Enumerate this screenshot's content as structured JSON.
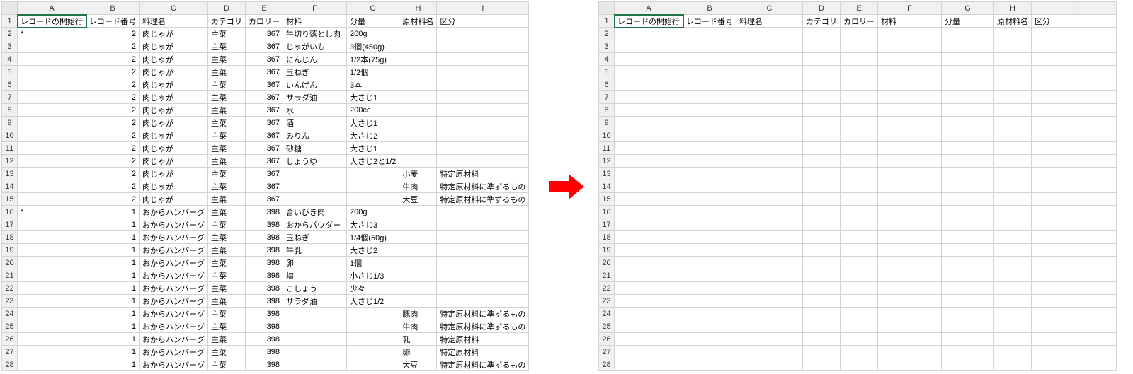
{
  "columns": [
    "A",
    "B",
    "C",
    "D",
    "E",
    "F",
    "G",
    "H",
    "I"
  ],
  "headers": {
    "A": "レコードの開始行",
    "B": "レコード番号",
    "C": "料理名",
    "D": "カテゴリ",
    "E": "カロリー",
    "F": "材料",
    "G": "分量",
    "H": "原材料名",
    "I": "区分"
  },
  "left_rows": [
    {
      "A": "*",
      "B": "2",
      "C": "肉じゃが",
      "D": "主菜",
      "E": "367",
      "F": "牛切り落とし肉",
      "G": "200g",
      "H": "",
      "I": ""
    },
    {
      "A": "",
      "B": "2",
      "C": "肉じゃが",
      "D": "主菜",
      "E": "367",
      "F": "じゃがいも",
      "G": "3個(450g)",
      "H": "",
      "I": ""
    },
    {
      "A": "",
      "B": "2",
      "C": "肉じゃが",
      "D": "主菜",
      "E": "367",
      "F": "にんじん",
      "G": "1/2本(75g)",
      "H": "",
      "I": ""
    },
    {
      "A": "",
      "B": "2",
      "C": "肉じゃが",
      "D": "主菜",
      "E": "367",
      "F": "玉ねぎ",
      "G": "1/2個",
      "H": "",
      "I": ""
    },
    {
      "A": "",
      "B": "2",
      "C": "肉じゃが",
      "D": "主菜",
      "E": "367",
      "F": "いんげん",
      "G": "3本",
      "H": "",
      "I": ""
    },
    {
      "A": "",
      "B": "2",
      "C": "肉じゃが",
      "D": "主菜",
      "E": "367",
      "F": "サラダ油",
      "G": "大さじ1",
      "H": "",
      "I": ""
    },
    {
      "A": "",
      "B": "2",
      "C": "肉じゃが",
      "D": "主菜",
      "E": "367",
      "F": "水",
      "G": "200cc",
      "H": "",
      "I": ""
    },
    {
      "A": "",
      "B": "2",
      "C": "肉じゃが",
      "D": "主菜",
      "E": "367",
      "F": "酒",
      "G": "大さじ1",
      "H": "",
      "I": ""
    },
    {
      "A": "",
      "B": "2",
      "C": "肉じゃが",
      "D": "主菜",
      "E": "367",
      "F": "みりん",
      "G": "大さじ2",
      "H": "",
      "I": ""
    },
    {
      "A": "",
      "B": "2",
      "C": "肉じゃが",
      "D": "主菜",
      "E": "367",
      "F": "砂糖",
      "G": "大さじ1",
      "H": "",
      "I": ""
    },
    {
      "A": "",
      "B": "2",
      "C": "肉じゃが",
      "D": "主菜",
      "E": "367",
      "F": "しょうゆ",
      "G": "大さじ2と1/2",
      "H": "",
      "I": ""
    },
    {
      "A": "",
      "B": "2",
      "C": "肉じゃが",
      "D": "主菜",
      "E": "367",
      "F": "",
      "G": "",
      "H": "小麦",
      "I": "特定原材料"
    },
    {
      "A": "",
      "B": "2",
      "C": "肉じゃが",
      "D": "主菜",
      "E": "367",
      "F": "",
      "G": "",
      "H": "牛肉",
      "I": "特定原材料に準ずるもの"
    },
    {
      "A": "",
      "B": "2",
      "C": "肉じゃが",
      "D": "主菜",
      "E": "367",
      "F": "",
      "G": "",
      "H": "大豆",
      "I": "特定原材料に準ずるもの"
    },
    {
      "A": "*",
      "B": "1",
      "C": "おからハンバーグ",
      "D": "主菜",
      "E": "398",
      "F": "合いびき肉",
      "G": "200g",
      "H": "",
      "I": ""
    },
    {
      "A": "",
      "B": "1",
      "C": "おからハンバーグ",
      "D": "主菜",
      "E": "398",
      "F": "おからパウダー",
      "G": "大さじ3",
      "H": "",
      "I": ""
    },
    {
      "A": "",
      "B": "1",
      "C": "おからハンバーグ",
      "D": "主菜",
      "E": "398",
      "F": "玉ねぎ",
      "G": "1/4個(50g)",
      "H": "",
      "I": ""
    },
    {
      "A": "",
      "B": "1",
      "C": "おからハンバーグ",
      "D": "主菜",
      "E": "398",
      "F": "牛乳",
      "G": "大さじ2",
      "H": "",
      "I": ""
    },
    {
      "A": "",
      "B": "1",
      "C": "おからハンバーグ",
      "D": "主菜",
      "E": "398",
      "F": "卵",
      "G": "1個",
      "H": "",
      "I": ""
    },
    {
      "A": "",
      "B": "1",
      "C": "おからハンバーグ",
      "D": "主菜",
      "E": "398",
      "F": "塩",
      "G": "小さじ1/3",
      "H": "",
      "I": ""
    },
    {
      "A": "",
      "B": "1",
      "C": "おからハンバーグ",
      "D": "主菜",
      "E": "398",
      "F": "こしょう",
      "G": "少々",
      "H": "",
      "I": ""
    },
    {
      "A": "",
      "B": "1",
      "C": "おからハンバーグ",
      "D": "主菜",
      "E": "398",
      "F": "サラダ油",
      "G": "大さじ1/2",
      "H": "",
      "I": ""
    },
    {
      "A": "",
      "B": "1",
      "C": "おからハンバーグ",
      "D": "主菜",
      "E": "398",
      "F": "",
      "G": "",
      "H": "豚肉",
      "I": "特定原材料に準ずるもの"
    },
    {
      "A": "",
      "B": "1",
      "C": "おからハンバーグ",
      "D": "主菜",
      "E": "398",
      "F": "",
      "G": "",
      "H": "牛肉",
      "I": "特定原材料に準ずるもの"
    },
    {
      "A": "",
      "B": "1",
      "C": "おからハンバーグ",
      "D": "主菜",
      "E": "398",
      "F": "",
      "G": "",
      "H": "乳",
      "I": "特定原材料"
    },
    {
      "A": "",
      "B": "1",
      "C": "おからハンバーグ",
      "D": "主菜",
      "E": "398",
      "F": "",
      "G": "",
      "H": "卵",
      "I": "特定原材料"
    },
    {
      "A": "",
      "B": "1",
      "C": "おからハンバーグ",
      "D": "主菜",
      "E": "398",
      "F": "",
      "G": "",
      "H": "大豆",
      "I": "特定原材料に準ずるもの"
    }
  ],
  "right_rows_count": 27,
  "arrow_color": "#ff0000"
}
